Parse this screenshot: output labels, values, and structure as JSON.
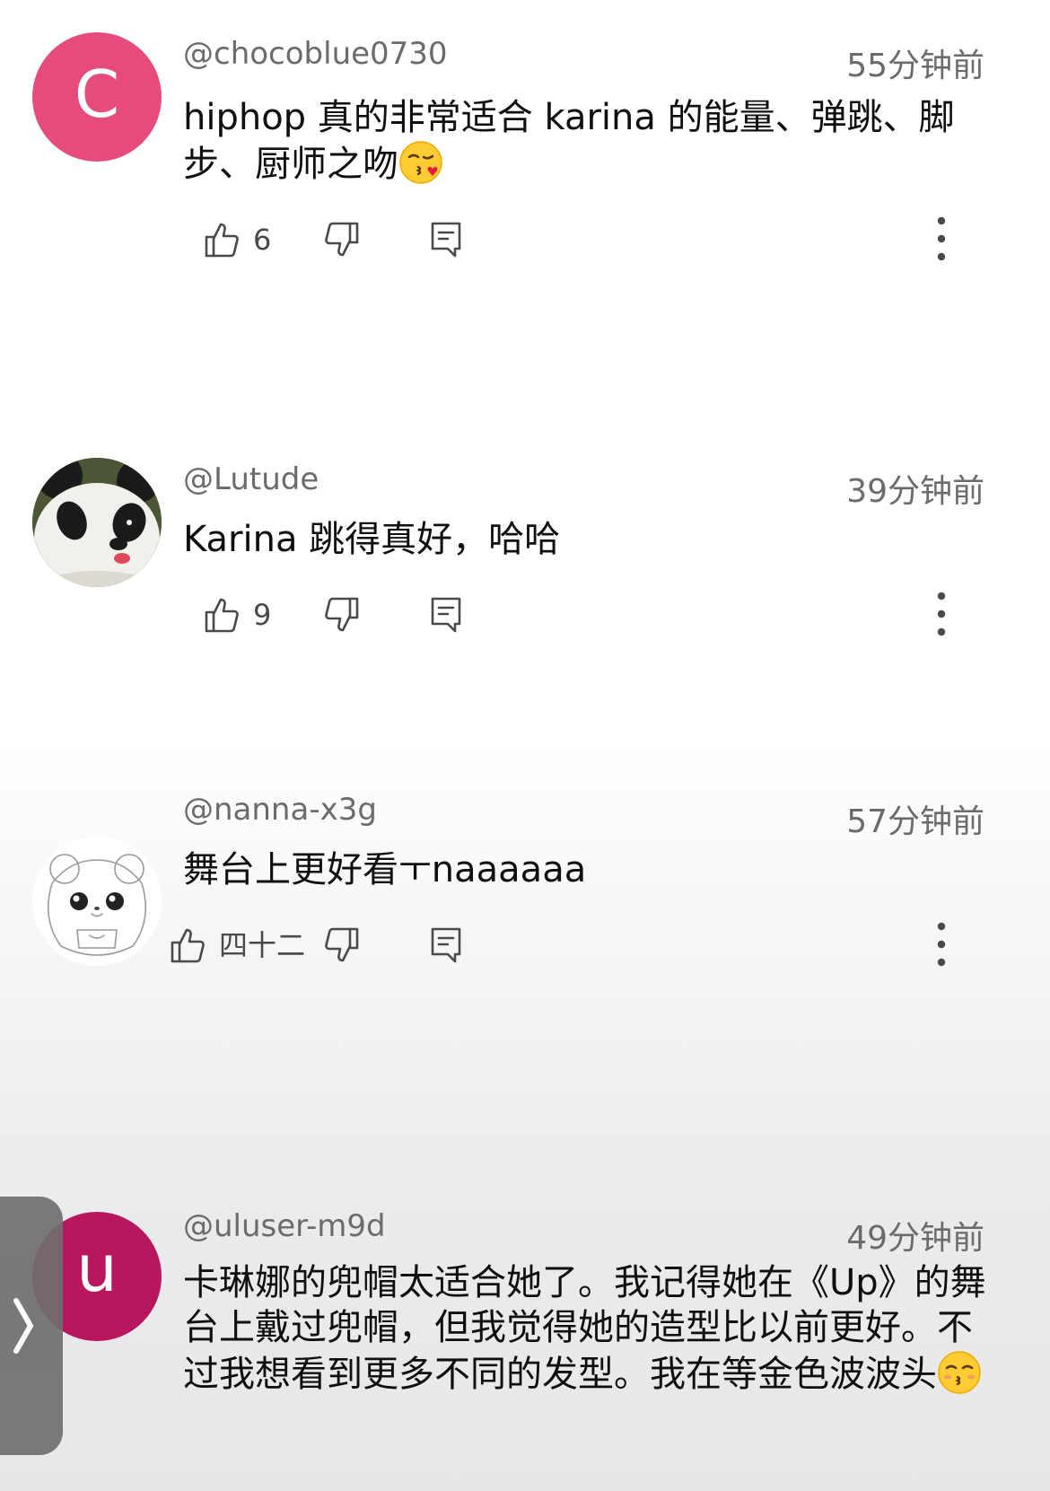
{
  "colors": {
    "avatar_c": "#E54C7C",
    "avatar_u": "#B8175E",
    "secondary_text": "#6B6B6B",
    "primary_text": "#0F0F0F"
  },
  "comments": [
    {
      "handle": "@chocoblue0730",
      "time": "55分钟前",
      "avatar_letter": "C",
      "text": "hiphop 真的非常适合 karina 的能量、弹跳、脚步、厨师之吻",
      "emoji": "kissing-face-with-heart",
      "likes": "6"
    },
    {
      "handle": "@Lutude",
      "time": "39分钟前",
      "avatar_icon": "panda-avatar",
      "text": "Karina 跳得真好，哈哈",
      "likes": "9"
    },
    {
      "handle": "@nanna-x3g",
      "time": "57分钟前",
      "avatar_icon": "hamster-sketch-avatar",
      "text": "舞台上更好看ㅜnaaaaaa",
      "likes": "四十二"
    },
    {
      "handle": "@uluser-m9d",
      "time": "49分钟前",
      "avatar_letter": "u",
      "text": "卡琳娜的兜帽太适合她了。我记得她在《Up》的舞台上戴过兜帽，但我觉得她的造型比以前更好。不过我想看到更多不同的发型。我在等金色波波头",
      "emoji": "kissing-face"
    }
  ],
  "icons": {
    "like": "thumbs-up-icon",
    "dislike": "thumbs-down-icon",
    "reply": "reply-comment-icon",
    "more": "more-vertical-icon",
    "side_tab": "chevron-right-icon"
  }
}
